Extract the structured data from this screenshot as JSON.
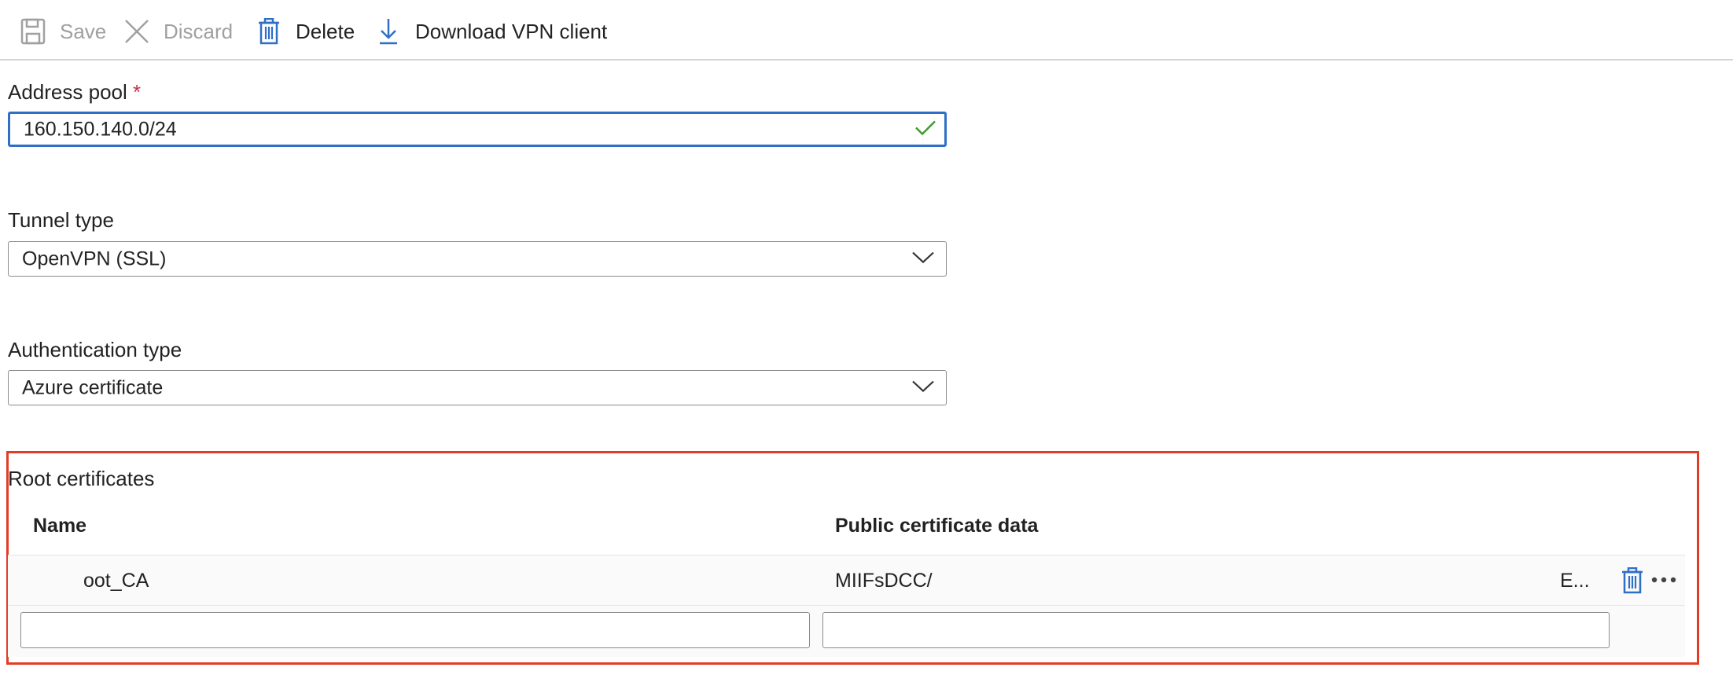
{
  "toolbar": {
    "save_label": "Save",
    "discard_label": "Discard",
    "delete_label": "Delete",
    "download_label": "Download VPN client"
  },
  "address_pool": {
    "label": "Address pool",
    "required_mark": "*",
    "value": "160.150.140.0/24"
  },
  "tunnel_type": {
    "label": "Tunnel type",
    "selected": "OpenVPN (SSL)"
  },
  "authentication_type": {
    "label": "Authentication type",
    "selected": "Azure certificate"
  },
  "root_certificates": {
    "title": "Root certificates",
    "columns": [
      "Name",
      "Public certificate data"
    ],
    "rows": [
      {
        "name": "oot_CA",
        "data": "MIIFsDCC/",
        "data_tail": "E..."
      }
    ]
  },
  "colors": {
    "accent": "#2f6fc6",
    "highlight_border": "#e23c25",
    "success": "#3f9b2f",
    "disabled_text": "#a0a0a0"
  }
}
